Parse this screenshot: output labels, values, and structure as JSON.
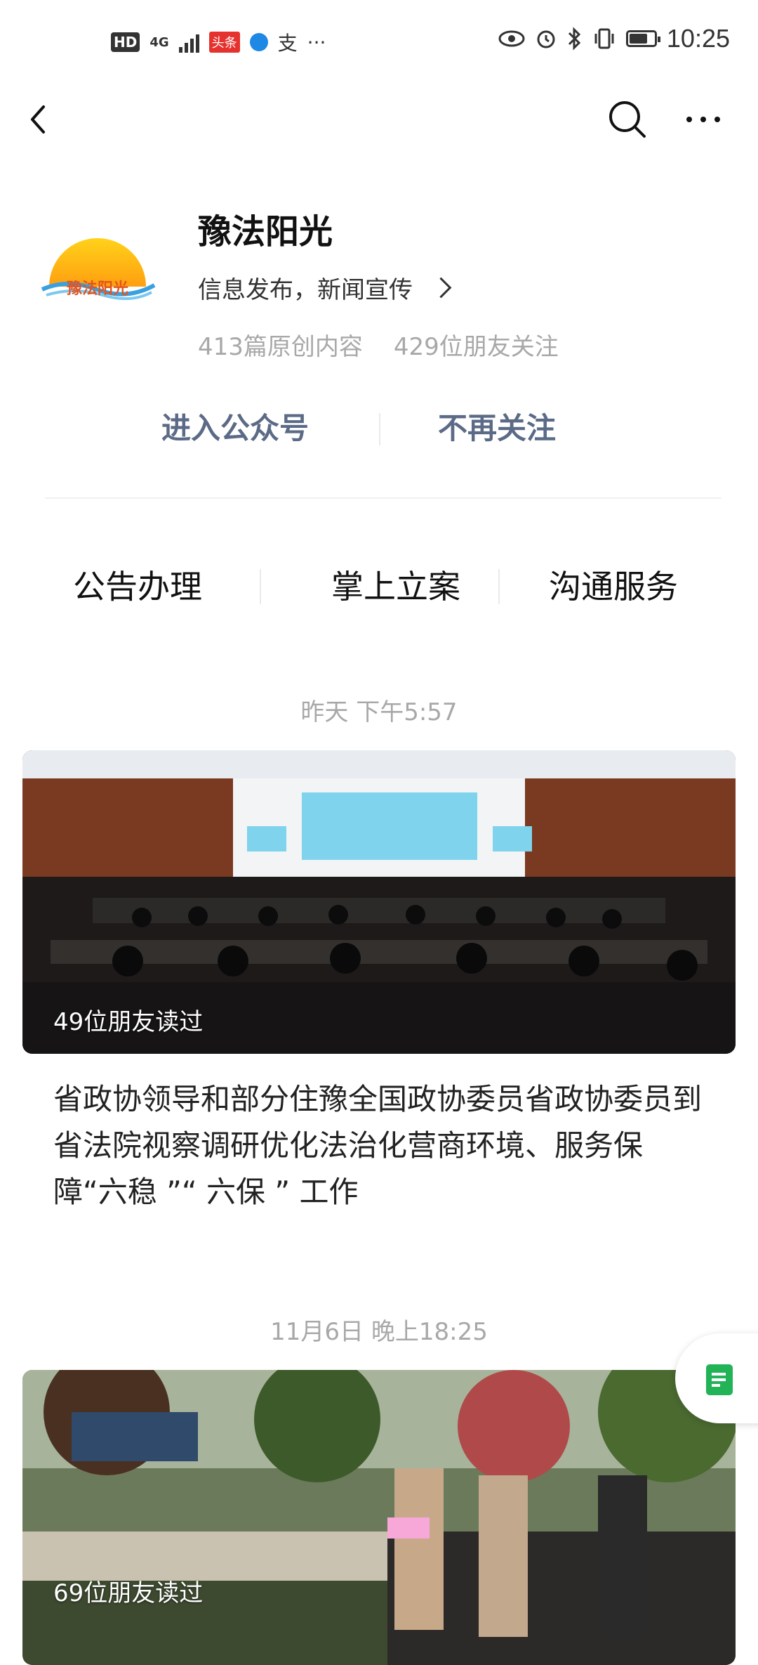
{
  "status_bar": {
    "hd": "HD",
    "network": "4G",
    "toutiao": "头条",
    "alipay": "支",
    "more": "···",
    "time": "10:25",
    "battery_level": 0.75,
    "icons": [
      "eye-icon",
      "alarm-icon",
      "bluetooth-icon",
      "vibrate-icon",
      "battery-icon"
    ]
  },
  "nav": {
    "icons": [
      "back-icon",
      "search-icon",
      "more-icon"
    ]
  },
  "profile": {
    "name": "豫法阳光",
    "logo_text": "豫法阳光",
    "description": "信息发布，新闻宣传",
    "original_count": "413篇原创内容",
    "friends_follow": "429位朋友关注"
  },
  "actions": {
    "enter": "进入公众号",
    "unfollow": "不再关注"
  },
  "menu": [
    "公告办理",
    "掌上立案",
    "沟通服务"
  ],
  "feed": [
    {
      "date": "昨天 下午5:57",
      "read_count": "49位朋友读过",
      "title": "省政协领导和部分住豫全国政协委员省政协委员到省法院视察调研优化法治化营商环境、服务保障“六稳 ”“ 六保 ” 工作"
    },
    {
      "date": "11月6日 晚上18:25",
      "read_count": "69位朋友读过"
    }
  ],
  "colors": {
    "action_text": "#5b6a86",
    "meta_gray": "#a8a8a8",
    "float_icon_green": "#21b356"
  }
}
